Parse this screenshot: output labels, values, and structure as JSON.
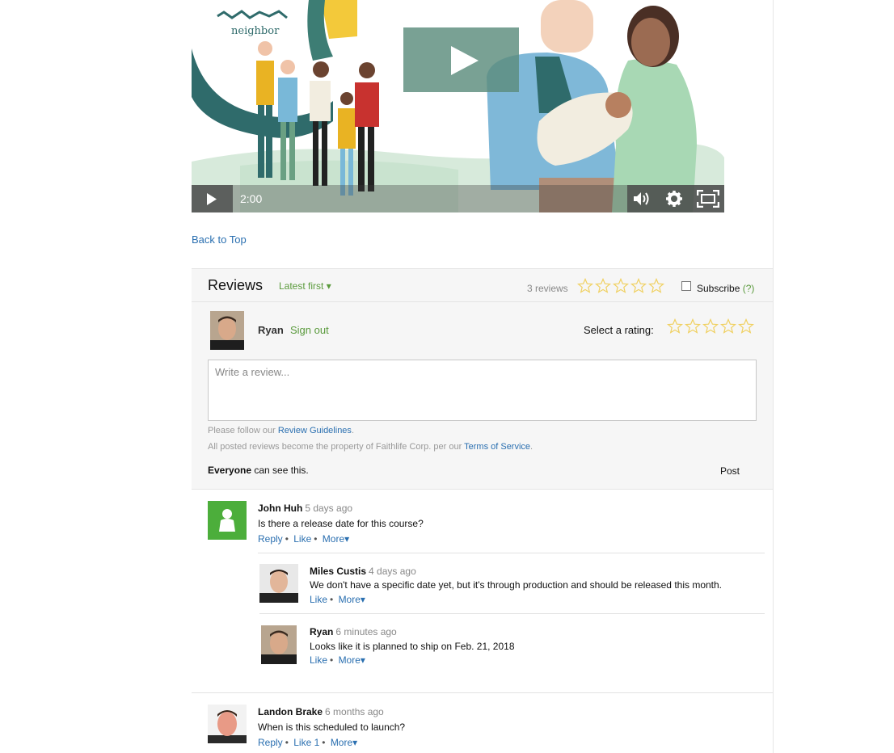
{
  "video": {
    "logo_text": "neighbor",
    "time": "2:00"
  },
  "back_to_top": "Back to Top",
  "reviews": {
    "title": "Reviews",
    "sort_label": "Latest first ▾",
    "count": "3 reviews",
    "star_color": "#f0d060",
    "subscribe_label": "Subscribe",
    "subscribe_help": "(?)"
  },
  "compose": {
    "user_name": "Ryan",
    "sign_out": "Sign out",
    "rating_label": "Select a rating:",
    "placeholder": "Write a review...",
    "guidelines_prefix": "Please follow our ",
    "guidelines_link": "Review Guidelines",
    "guidelines_suffix": ".",
    "property_prefix": "All posted reviews become the property of Faithlife Corp. per our ",
    "tos_link": "Terms of Service",
    "property_suffix": ".",
    "visibility_bold": "Everyone",
    "visibility_rest": " can see this.",
    "post_label": "Post"
  },
  "comments": [
    {
      "author": "John Huh",
      "time": "5 days ago",
      "text": "Is there a release date for this course?",
      "reply": "Reply",
      "like": "Like",
      "more": "More▾"
    },
    {
      "author": "Miles Custis",
      "time": "4 days ago",
      "text": "We don't have a specific date yet, but it's through production and should be released this month.",
      "like": "Like",
      "more": "More▾"
    },
    {
      "author": "Ryan",
      "time": "6 minutes ago",
      "text": "Looks like it is planned to ship on Feb. 21, 2018",
      "like": "Like",
      "more": "More▾"
    },
    {
      "author": "Landon Brake",
      "time": "6 months ago",
      "text": "When is this scheduled to launch?",
      "reply": "Reply",
      "like": "Like 1",
      "more": "More▾"
    }
  ],
  "colors": {
    "link": "#2a6fb0",
    "green": "#5a9a3c",
    "default_avatar": "#4cae3b"
  }
}
